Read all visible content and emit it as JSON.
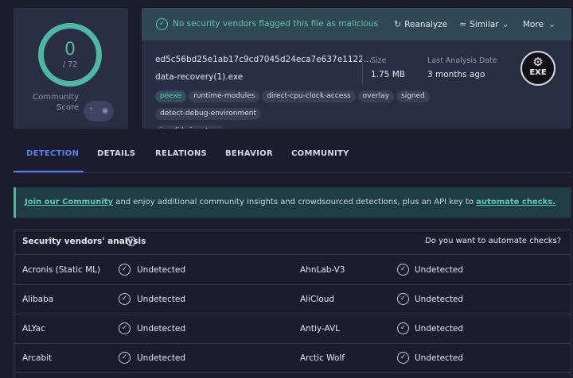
{
  "score": {
    "value": "0",
    "total": "/ 72",
    "label": "Community Score",
    "toggle_icon": "question-mark-icon"
  },
  "status": {
    "text": "No security vendors flagged this file as malicious",
    "color": "#5ac8b0"
  },
  "actions": {
    "reanalyze": "Reanalyze",
    "similar": "Similar",
    "more": "More"
  },
  "file": {
    "hash": "ed5c56bd25e1ab17c9cd7045d24eca7e637e1122...",
    "name": "data-recovery(1).exe",
    "tags": [
      "peexe",
      "runtime-modules",
      "direct-cpu-clock-access",
      "overlay",
      "signed",
      "detect-debug-environment",
      "invalid-signature"
    ]
  },
  "meta": {
    "size_label": "Size",
    "size_value": "1.75 MB",
    "date_label": "Last Analysis Date",
    "date_value": "3 months ago",
    "type_icon_label": "EXE"
  },
  "tabs": [
    "DETECTION",
    "DETAILS",
    "RELATIONS",
    "BEHAVIOR",
    "COMMUNITY"
  ],
  "banner": {
    "join_link": "Join our Community",
    "middle": " and enjoy additional community insights and crowdsourced detections, plus an API key to ",
    "automate_link": "automate checks."
  },
  "analysis": {
    "title": "Security vendors' analysis",
    "automate_question": "Do you want to automate checks?",
    "rows": [
      [
        {
          "vendor": "Acronis (Static ML)",
          "result": "Undetected"
        },
        {
          "vendor": "AhnLab-V3",
          "result": "Undetected"
        }
      ],
      [
        {
          "vendor": "Alibaba",
          "result": "Undetected"
        },
        {
          "vendor": "AliCloud",
          "result": "Undetected"
        }
      ],
      [
        {
          "vendor": "ALYac",
          "result": "Undetected"
        },
        {
          "vendor": "Antiy-AVL",
          "result": "Undetected"
        }
      ],
      [
        {
          "vendor": "Arcabit",
          "result": "Undetected"
        },
        {
          "vendor": "Arctic Wolf",
          "result": "Undetected"
        }
      ]
    ]
  },
  "colors": {
    "accent": "#5b7cf5",
    "teal": "#4fb8a4",
    "background": "#1b1d2c",
    "card": "#2a2e44"
  }
}
